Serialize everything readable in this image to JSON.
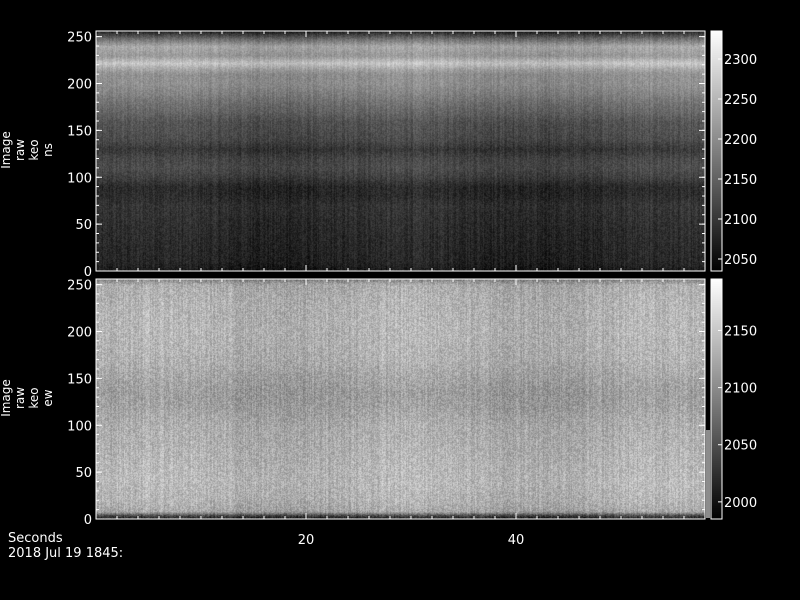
{
  "chart_data": [
    {
      "type": "heatmap",
      "panel": "top",
      "ylabel_lines": [
        "Image",
        "raw",
        "keo",
        "ns"
      ],
      "x_range": [
        0,
        58
      ],
      "x_ticks": [
        20,
        40
      ],
      "ylim": [
        0,
        256
      ],
      "y_ticks": [
        0,
        50,
        100,
        150,
        200,
        250
      ],
      "colorbar": {
        "range": [
          2035,
          2335
        ],
        "ticks": [
          2050,
          2100,
          2150,
          2200,
          2250,
          2300
        ]
      },
      "row_profile": {
        "y": [
          0,
          10,
          30,
          50,
          70,
          80,
          90,
          100,
          110,
          120,
          130,
          140,
          150,
          160,
          170,
          180,
          190,
          200,
          210,
          215,
          222,
          230,
          240,
          248,
          256
        ],
        "value": [
          2060,
          2075,
          2080,
          2085,
          2092,
          2082,
          2080,
          2105,
          2120,
          2115,
          2095,
          2118,
          2125,
          2130,
          2150,
          2165,
          2185,
          2200,
          2200,
          2220,
          2265,
          2210,
          2230,
          2160,
          2070
        ]
      },
      "column_variation": 12,
      "noise": 18
    },
    {
      "type": "heatmap",
      "panel": "bottom",
      "ylabel_lines": [
        "Image",
        "raw",
        "keo",
        "ew"
      ],
      "x_range": [
        0,
        58
      ],
      "x_ticks": [
        20,
        40
      ],
      "ylim": [
        0,
        256
      ],
      "y_ticks": [
        0,
        50,
        100,
        150,
        200,
        250
      ],
      "colorbar": {
        "range": [
          1985,
          2195
        ],
        "ticks": [
          2000,
          2050,
          2100,
          2150
        ]
      },
      "row_profile": {
        "y": [
          0,
          4,
          8,
          20,
          40,
          60,
          80,
          100,
          120,
          135,
          150,
          170,
          200,
          230,
          250,
          256
        ],
        "value": [
          2000,
          2040,
          2120,
          2130,
          2135,
          2132,
          2128,
          2125,
          2115,
          2112,
          2118,
          2128,
          2132,
          2130,
          2125,
          2090
        ]
      },
      "column_variation": 10,
      "noise": 22
    }
  ],
  "footer": {
    "x_axis_title": "Seconds",
    "date_line": "2018 Jul 19 1845:"
  }
}
